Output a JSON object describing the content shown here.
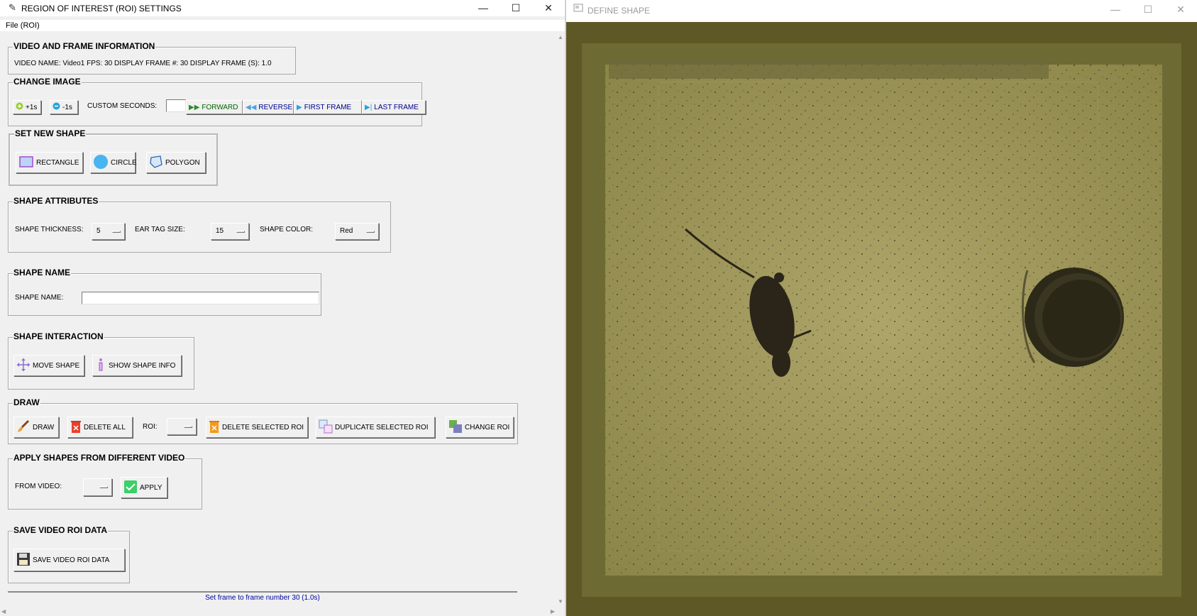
{
  "left_window": {
    "title": "REGION OF INTEREST (ROI) SETTINGS",
    "menu": [
      "File (ROI)"
    ],
    "sections": {
      "video_info": {
        "title": "VIDEO AND FRAME INFORMATION",
        "text": "VIDEO NAME: Video1  FPS: 30  DISPLAY FRAME #: 30  DISPLAY FRAME (S): 1.0"
      },
      "change_image": {
        "title": "CHANGE IMAGE",
        "plus_label": "+1s",
        "minus_label": "-1s",
        "custom_seconds_label": "CUSTOM SECONDS:",
        "custom_seconds_value": "",
        "forward_label": "FORWARD",
        "reverse_label": "REVERSE",
        "first_frame_label": "FIRST FRAME",
        "last_frame_label": "LAST FRAME"
      },
      "set_shape": {
        "title": "SET NEW SHAPE",
        "rectangle_label": "RECTANGLE",
        "circle_label": "CIRCLE",
        "polygon_label": "POLYGON"
      },
      "shape_attributes": {
        "title": "SHAPE ATTRIBUTES",
        "thickness_label": "SHAPE THICKNESS:",
        "thickness_value": "5",
        "ear_tag_label": "EAR TAG SIZE:",
        "ear_tag_value": "15",
        "color_label": "SHAPE COLOR:",
        "color_value": "Red"
      },
      "shape_name": {
        "title": "SHAPE NAME",
        "label": "SHAPE NAME:",
        "value": ""
      },
      "shape_interaction": {
        "title": "SHAPE INTERACTION",
        "move_label": "MOVE SHAPE",
        "info_label": "SHOW SHAPE INFO"
      },
      "draw": {
        "title": "DRAW",
        "draw_label": "DRAW",
        "delete_all_label": "DELETE ALL",
        "roi_label": "ROI:",
        "roi_value": "",
        "delete_selected_label": "DELETE SELECTED ROI",
        "duplicate_label": "DUPLICATE SELECTED ROI",
        "change_label": "CHANGE ROI"
      },
      "apply_shapes": {
        "title": "APPLY SHAPES FROM DIFFERENT VIDEO",
        "from_label": "FROM VIDEO:",
        "from_value": "",
        "apply_label": "APPLY"
      },
      "save": {
        "title": "SAVE VIDEO ROI DATA",
        "save_label": "SAVE VIDEO ROI DATA"
      }
    },
    "status": "Set frame to frame number 30 (1.0s)"
  },
  "right_window": {
    "title": "DEFINE SHAPE"
  },
  "colors": {
    "window_bg": "#f0f0f0",
    "status_text": "#0000a0",
    "video_bg": "#5f5a27"
  }
}
